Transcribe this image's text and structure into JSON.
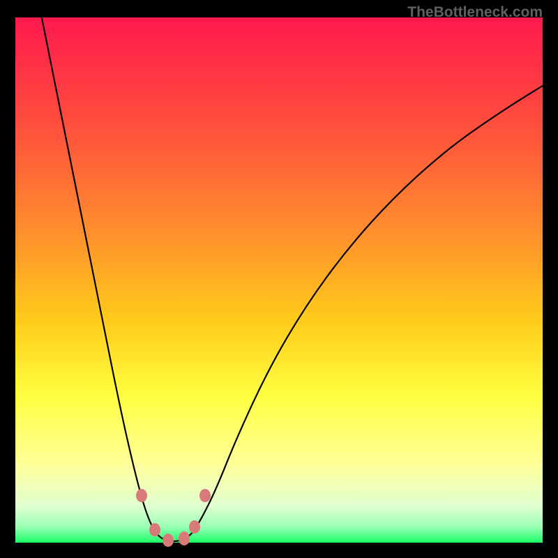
{
  "watermark": "TheBottleneck.com",
  "chart_data": {
    "type": "line",
    "title": "",
    "xlabel": "",
    "ylabel": "",
    "x_range": [
      0,
      100
    ],
    "y_range": [
      0,
      100
    ],
    "curve_points": [
      {
        "x": 5,
        "y": 100
      },
      {
        "x": 8,
        "y": 85
      },
      {
        "x": 12,
        "y": 65
      },
      {
        "x": 16,
        "y": 45
      },
      {
        "x": 20,
        "y": 25
      },
      {
        "x": 23,
        "y": 12
      },
      {
        "x": 25,
        "y": 5
      },
      {
        "x": 27,
        "y": 1
      },
      {
        "x": 30,
        "y": 0
      },
      {
        "x": 33,
        "y": 1
      },
      {
        "x": 35,
        "y": 4
      },
      {
        "x": 38,
        "y": 10
      },
      {
        "x": 42,
        "y": 20
      },
      {
        "x": 48,
        "y": 33
      },
      {
        "x": 55,
        "y": 45
      },
      {
        "x": 63,
        "y": 56
      },
      {
        "x": 72,
        "y": 66
      },
      {
        "x": 82,
        "y": 75
      },
      {
        "x": 92,
        "y": 82
      },
      {
        "x": 100,
        "y": 87
      }
    ],
    "markers": [
      {
        "x": 24,
        "y": 9
      },
      {
        "x": 26.5,
        "y": 2.5
      },
      {
        "x": 29,
        "y": 0.5
      },
      {
        "x": 32,
        "y": 0.8
      },
      {
        "x": 34,
        "y": 3
      },
      {
        "x": 36,
        "y": 9
      }
    ],
    "gradient_colors": {
      "top": "#ff1a4d",
      "upper_mid": "#ff6633",
      "mid": "#ffcc1a",
      "lower_mid": "#ffff66",
      "pale": "#e6ffcc",
      "bottom": "#1aff66"
    }
  }
}
